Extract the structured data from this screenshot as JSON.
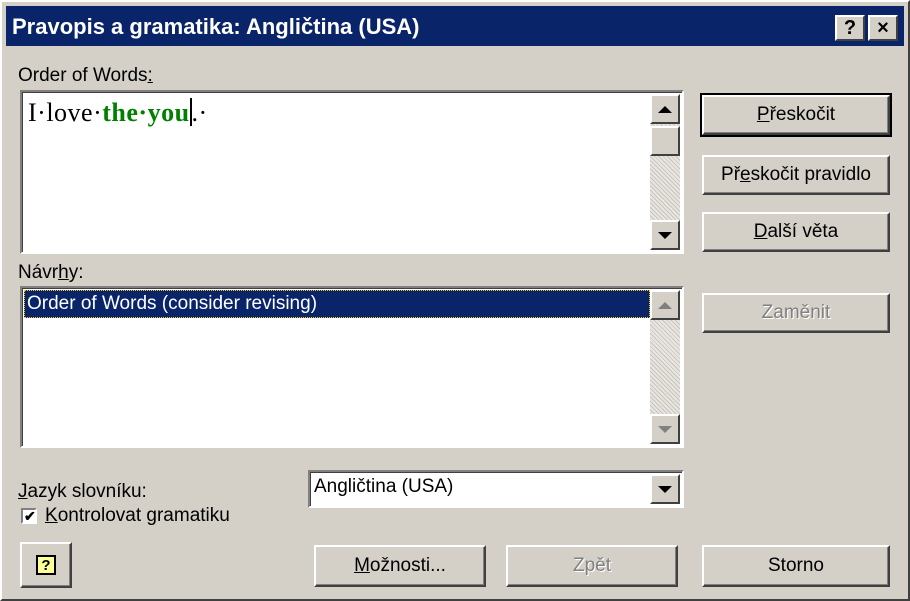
{
  "window": {
    "title": "Pravopis a gramatika: Angličtina (USA)",
    "help_btn": "?",
    "close_btn": "×"
  },
  "error_section": {
    "label_main": "Order of Words",
    "label_colon": ":",
    "sentence_normal": "I·love·",
    "sentence_highlight": "the·you",
    "sentence_tail": ".·"
  },
  "suggestions_section": {
    "label_pre": "Návr",
    "label_accel": "h",
    "label_post": "y:",
    "items": [
      "Order of Words (consider revising)"
    ]
  },
  "buttons": {
    "skip_pre": "",
    "skip_accel": "P",
    "skip_post": "řeskočit",
    "skip_rule_pre": "Př",
    "skip_rule_accel": "e",
    "skip_rule_post": "skočit pravidlo",
    "next_sentence_pre": "",
    "next_sentence_accel": "D",
    "next_sentence_post": "alší věta",
    "replace": "Zaměnit",
    "options_pre": "",
    "options_accel": "M",
    "options_post": "ožnosti...",
    "undo": "Zpět",
    "cancel": "Storno"
  },
  "language": {
    "label_accel": "J",
    "label_post": "azyk slovníku:",
    "selected": "Angličtina (USA)"
  },
  "grammar_check": {
    "checked": true,
    "label_accel": "K",
    "label_post": "ontrolovat gramatiku"
  },
  "icons": {
    "help": "help-question-icon",
    "check": "✔"
  },
  "colors": {
    "titlebar": "#0a246a",
    "dialog_face": "#d4d0c8",
    "grammar_error": "#008000",
    "selection": "#0a246a"
  }
}
